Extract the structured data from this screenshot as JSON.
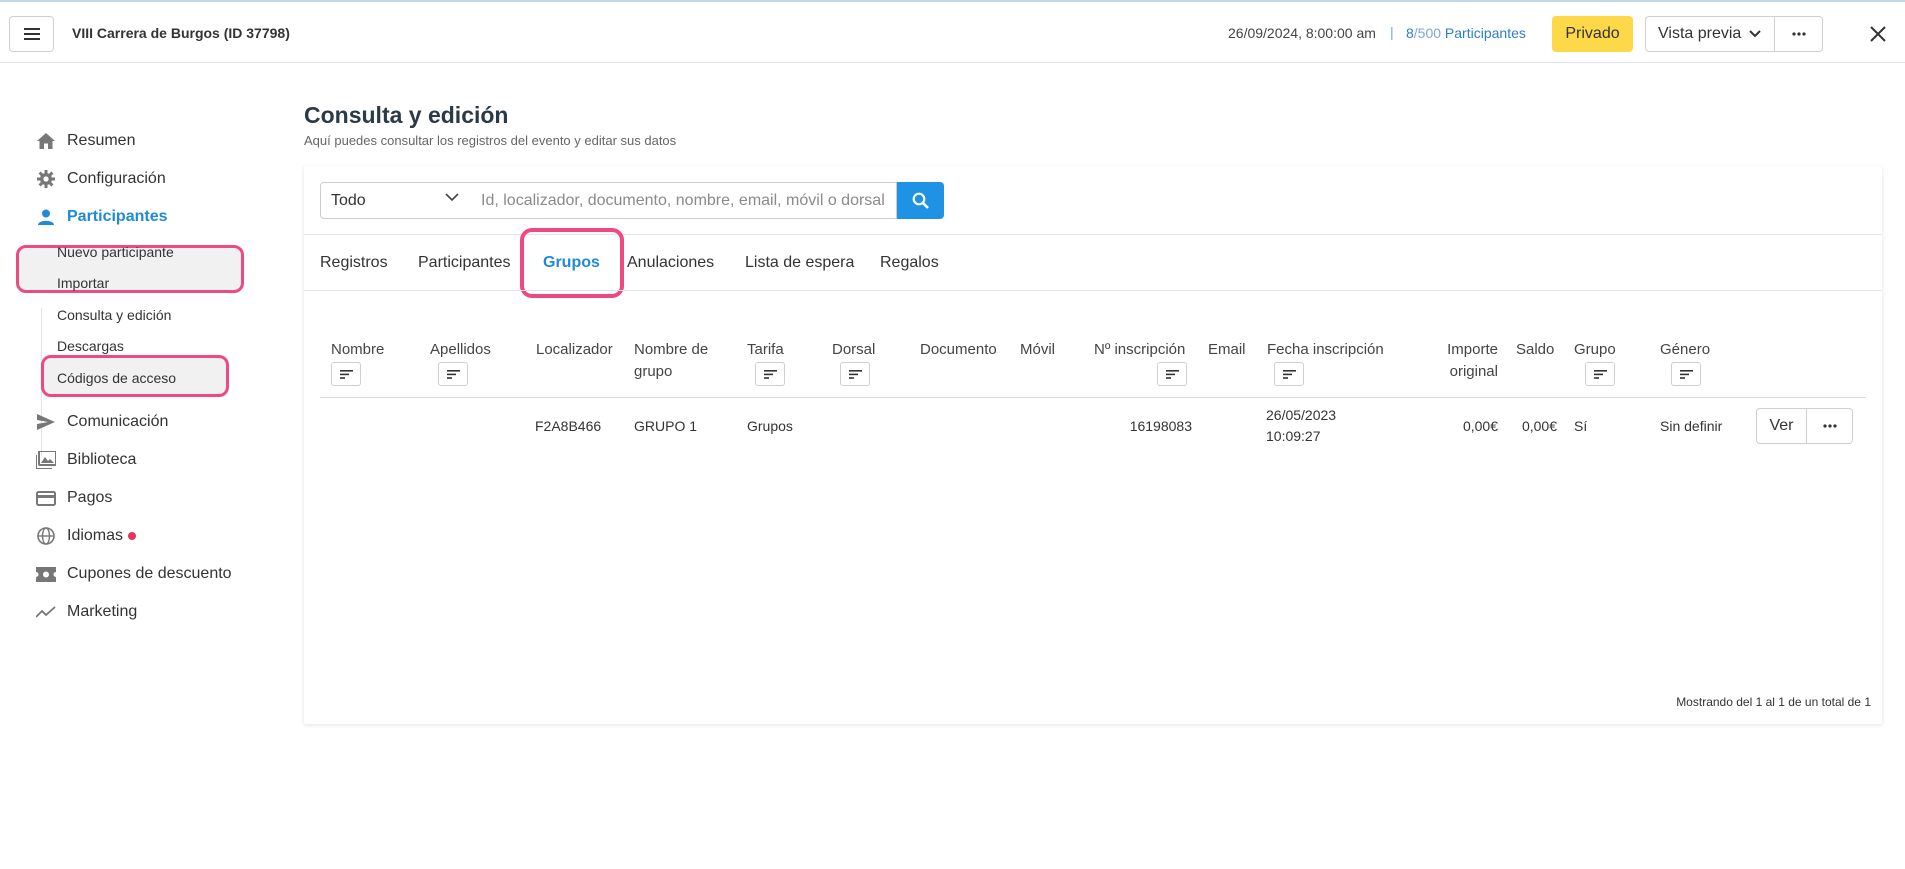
{
  "header": {
    "event_title": "VIII Carrera de Burgos (ID 37798)",
    "date": "26/09/2024, 8:00:00 am",
    "separator": "|",
    "count_current": "8",
    "count_total": "/500",
    "count_label": " Participantes",
    "privado_label": "Privado",
    "vista_previa_label": "Vista previa"
  },
  "sidebar": {
    "items": [
      {
        "label": "Resumen",
        "icon": "home-icon"
      },
      {
        "label": "Configuración",
        "icon": "gear-icon"
      },
      {
        "label": "Participantes",
        "icon": "person-icon"
      },
      {
        "label": "Comunicación",
        "icon": "send-icon"
      },
      {
        "label": "Biblioteca",
        "icon": "images-icon"
      },
      {
        "label": "Pagos",
        "icon": "credit-card-icon"
      },
      {
        "label": "Idiomas",
        "icon": "globe-icon"
      },
      {
        "label": "Cupones de descuento",
        "icon": "ticket-icon"
      },
      {
        "label": "Marketing",
        "icon": "trend-icon"
      }
    ],
    "sub_items": [
      {
        "label": "Nuevo participante"
      },
      {
        "label": "Importar"
      },
      {
        "label": "Consulta y edición"
      },
      {
        "label": "Descargas"
      },
      {
        "label": "Códigos de acceso"
      }
    ]
  },
  "main": {
    "title": "Consulta y edición",
    "subtitle": "Aquí puedes consultar los registros del evento y editar sus datos",
    "search": {
      "filter_value": "Todo",
      "placeholder": "Id, localizador, documento, nombre, email, móvil o dorsal"
    },
    "tabs": [
      {
        "label": "Registros"
      },
      {
        "label": "Participantes"
      },
      {
        "label": "Grupos"
      },
      {
        "label": "Anulaciones"
      },
      {
        "label": "Lista de espera"
      },
      {
        "label": "Regalos"
      }
    ],
    "columns": {
      "nombre": "Nombre",
      "apellidos": "Apellidos",
      "localizador": "Localizador",
      "nombre_grupo_1": "Nombre de",
      "nombre_grupo_2": "grupo",
      "tarifa": "Tarifa",
      "dorsal": "Dorsal",
      "documento": "Documento",
      "movil": "Móvil",
      "inscripcion": "Nº inscripción",
      "email": "Email",
      "fecha": "Fecha inscripción",
      "importe_1": "Importe",
      "importe_2": "original",
      "saldo": "Saldo",
      "grupo": "Grupo",
      "genero": "Género"
    },
    "rows": [
      {
        "localizador": "F2A8B466",
        "nombre_grupo": "GRUPO 1",
        "tarifa": "Grupos",
        "inscripcion": "16198083",
        "fecha_1": "26/05/2023",
        "fecha_2": "10:09:27",
        "importe": "0,00€",
        "saldo": "0,00€",
        "grupo": "Sí",
        "genero": "Sin definir",
        "ver_label": "Ver"
      }
    ],
    "footer": "Mostrando del 1 al 1 de un total de 1"
  },
  "colors": {
    "accent": "#1f8ad6",
    "highlight": "#ee4a80",
    "privado": "#fdd94a",
    "search_button": "#1e93e6"
  }
}
